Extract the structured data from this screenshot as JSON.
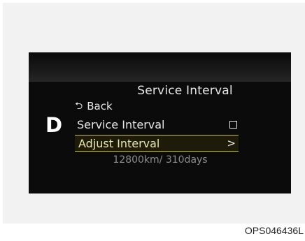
{
  "screen": {
    "title": "Service Interval",
    "back_label": "Back",
    "back_icon": "return-arrow-icon",
    "gear_indicator": "D",
    "menu": [
      {
        "label": "Service Interval",
        "control": "checkbox",
        "checked": false
      },
      {
        "label": "Adjust Interval",
        "control": "chevron",
        "chevron": ">",
        "selected": true
      }
    ],
    "interval_value": "12800km/ 310days"
  },
  "figure_code": "OPS046436L",
  "colors": {
    "display_bg": "#0b0b0b",
    "highlight_border": "#c8c020",
    "text": "#e6e6e6",
    "sub_text": "#8c8c8c"
  }
}
